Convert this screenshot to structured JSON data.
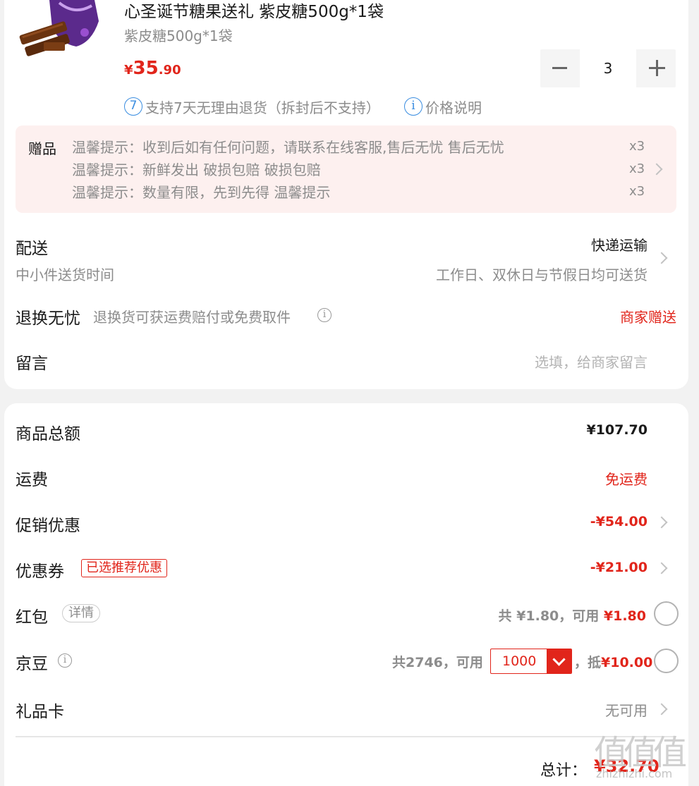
{
  "product": {
    "title": "心圣诞节糖果送礼 紫皮糖500g*1袋",
    "spec": "紫皮糖500g*1袋",
    "price_symbol": "¥",
    "price_int": "35",
    "price_dec": ".90",
    "quantity": "3",
    "return_badge": "7",
    "return_text": "支持7天无理由退货（拆封后不支持）",
    "price_note": "价格说明"
  },
  "gifts": {
    "label": "赠品",
    "items": [
      {
        "text": "温馨提示：收到后如有任何问题，请联系在线客服,售后无忧 售后无忧",
        "qty": "x3"
      },
      {
        "text": "温馨提示：新鲜发出 破损包赔 破损包赔",
        "qty": "x3"
      },
      {
        "text": "温馨提示：数量有限，先到先得 温馨提示",
        "qty": "x3"
      }
    ]
  },
  "delivery": {
    "label": "配送",
    "method": "快递运输",
    "sub_label": "中小件送货时间",
    "time": "工作日、双休日与节假日均可送货"
  },
  "return_worry": {
    "label": "退换无忧",
    "desc": "退换货可获运费赔付或免费取件",
    "value": "商家赠送"
  },
  "message": {
    "label": "留言",
    "placeholder": "选填，给商家留言"
  },
  "summary": {
    "goods_total_label": "商品总额",
    "goods_total": "¥107.70",
    "shipping_label": "运费",
    "shipping": "免运费",
    "promo_label": "促销优惠",
    "promo": "-¥54.00",
    "coupon_label": "优惠券",
    "coupon_tag": "已选推荐优惠",
    "coupon": "-¥21.00",
    "redpacket_label": "红包",
    "redpacket_detail": "详情",
    "redpacket_total": "共 ¥1.80，可用 ",
    "redpacket_avail": "¥1.80",
    "jd_label": "京豆",
    "jd_total": "共2746，可用",
    "jd_select": "1000",
    "jd_sep": "，抵",
    "jd_deduct": "¥10.00",
    "giftcard_label": "礼品卡",
    "giftcard": "无可用",
    "total_label": "总计：",
    "total": "¥32.70"
  },
  "watermark": {
    "logo": "值",
    "url": "zhizhizhi.com"
  },
  "colors": {
    "accent_red": "#e1251b",
    "gift_bg": "#fdf0ef",
    "page_bg": "#f2f2f2"
  }
}
